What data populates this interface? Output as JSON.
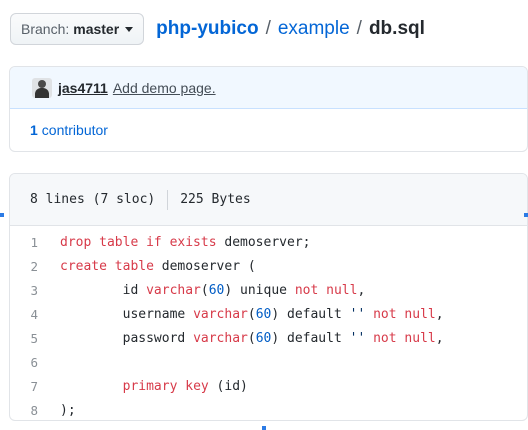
{
  "branch": {
    "label": "Branch:",
    "value": "master"
  },
  "breadcrumb": {
    "repo": "php-yubico",
    "sep1": "/",
    "folder": "example",
    "sep2": "/",
    "file": "db.sql"
  },
  "commit": {
    "author": "jas4711",
    "message": "Add demo page."
  },
  "contributors": {
    "count": "1",
    "label": "contributor"
  },
  "file_info": {
    "lines": "8 lines (7 sloc)",
    "size": "225 Bytes"
  },
  "code_lines": [
    {
      "num": "1",
      "tokens": [
        {
          "t": "drop table if exists",
          "c": "kw"
        },
        {
          "t": " demoserver;",
          "c": ""
        }
      ]
    },
    {
      "num": "2",
      "tokens": [
        {
          "t": "create table",
          "c": "kw"
        },
        {
          "t": " demoserver (",
          "c": ""
        }
      ]
    },
    {
      "num": "3",
      "tokens": [
        {
          "t": "\tid ",
          "c": ""
        },
        {
          "t": "varchar",
          "c": "kw"
        },
        {
          "t": "(",
          "c": ""
        },
        {
          "t": "60",
          "c": "nm"
        },
        {
          "t": ") unique ",
          "c": ""
        },
        {
          "t": "not null",
          "c": "kw"
        },
        {
          "t": ",",
          "c": ""
        }
      ]
    },
    {
      "num": "4",
      "tokens": [
        {
          "t": "\tusername ",
          "c": ""
        },
        {
          "t": "varchar",
          "c": "kw"
        },
        {
          "t": "(",
          "c": ""
        },
        {
          "t": "60",
          "c": "nm"
        },
        {
          "t": ") default ",
          "c": ""
        },
        {
          "t": "''",
          "c": "st"
        },
        {
          "t": " ",
          "c": ""
        },
        {
          "t": "not null",
          "c": "kw"
        },
        {
          "t": ",",
          "c": ""
        }
      ]
    },
    {
      "num": "5",
      "tokens": [
        {
          "t": "\tpassword ",
          "c": ""
        },
        {
          "t": "varchar",
          "c": "kw"
        },
        {
          "t": "(",
          "c": ""
        },
        {
          "t": "60",
          "c": "nm"
        },
        {
          "t": ") default ",
          "c": ""
        },
        {
          "t": "''",
          "c": "st"
        },
        {
          "t": " ",
          "c": ""
        },
        {
          "t": "not null",
          "c": "kw"
        },
        {
          "t": ",",
          "c": ""
        }
      ]
    },
    {
      "num": "6",
      "tokens": []
    },
    {
      "num": "7",
      "tokens": [
        {
          "t": "\t",
          "c": ""
        },
        {
          "t": "primary key",
          "c": "kw"
        },
        {
          "t": " (id)",
          "c": ""
        }
      ]
    },
    {
      "num": "8",
      "tokens": [
        {
          "t": ");",
          "c": ""
        }
      ]
    }
  ],
  "colors": {
    "link": "#0366d6",
    "keyword": "#d73a49",
    "number": "#005cc5",
    "string": "#032f62",
    "commit_bg": "#f1f8ff"
  },
  "icons": {
    "avatar": "avatar-icon",
    "caret": "caret-down-icon"
  }
}
